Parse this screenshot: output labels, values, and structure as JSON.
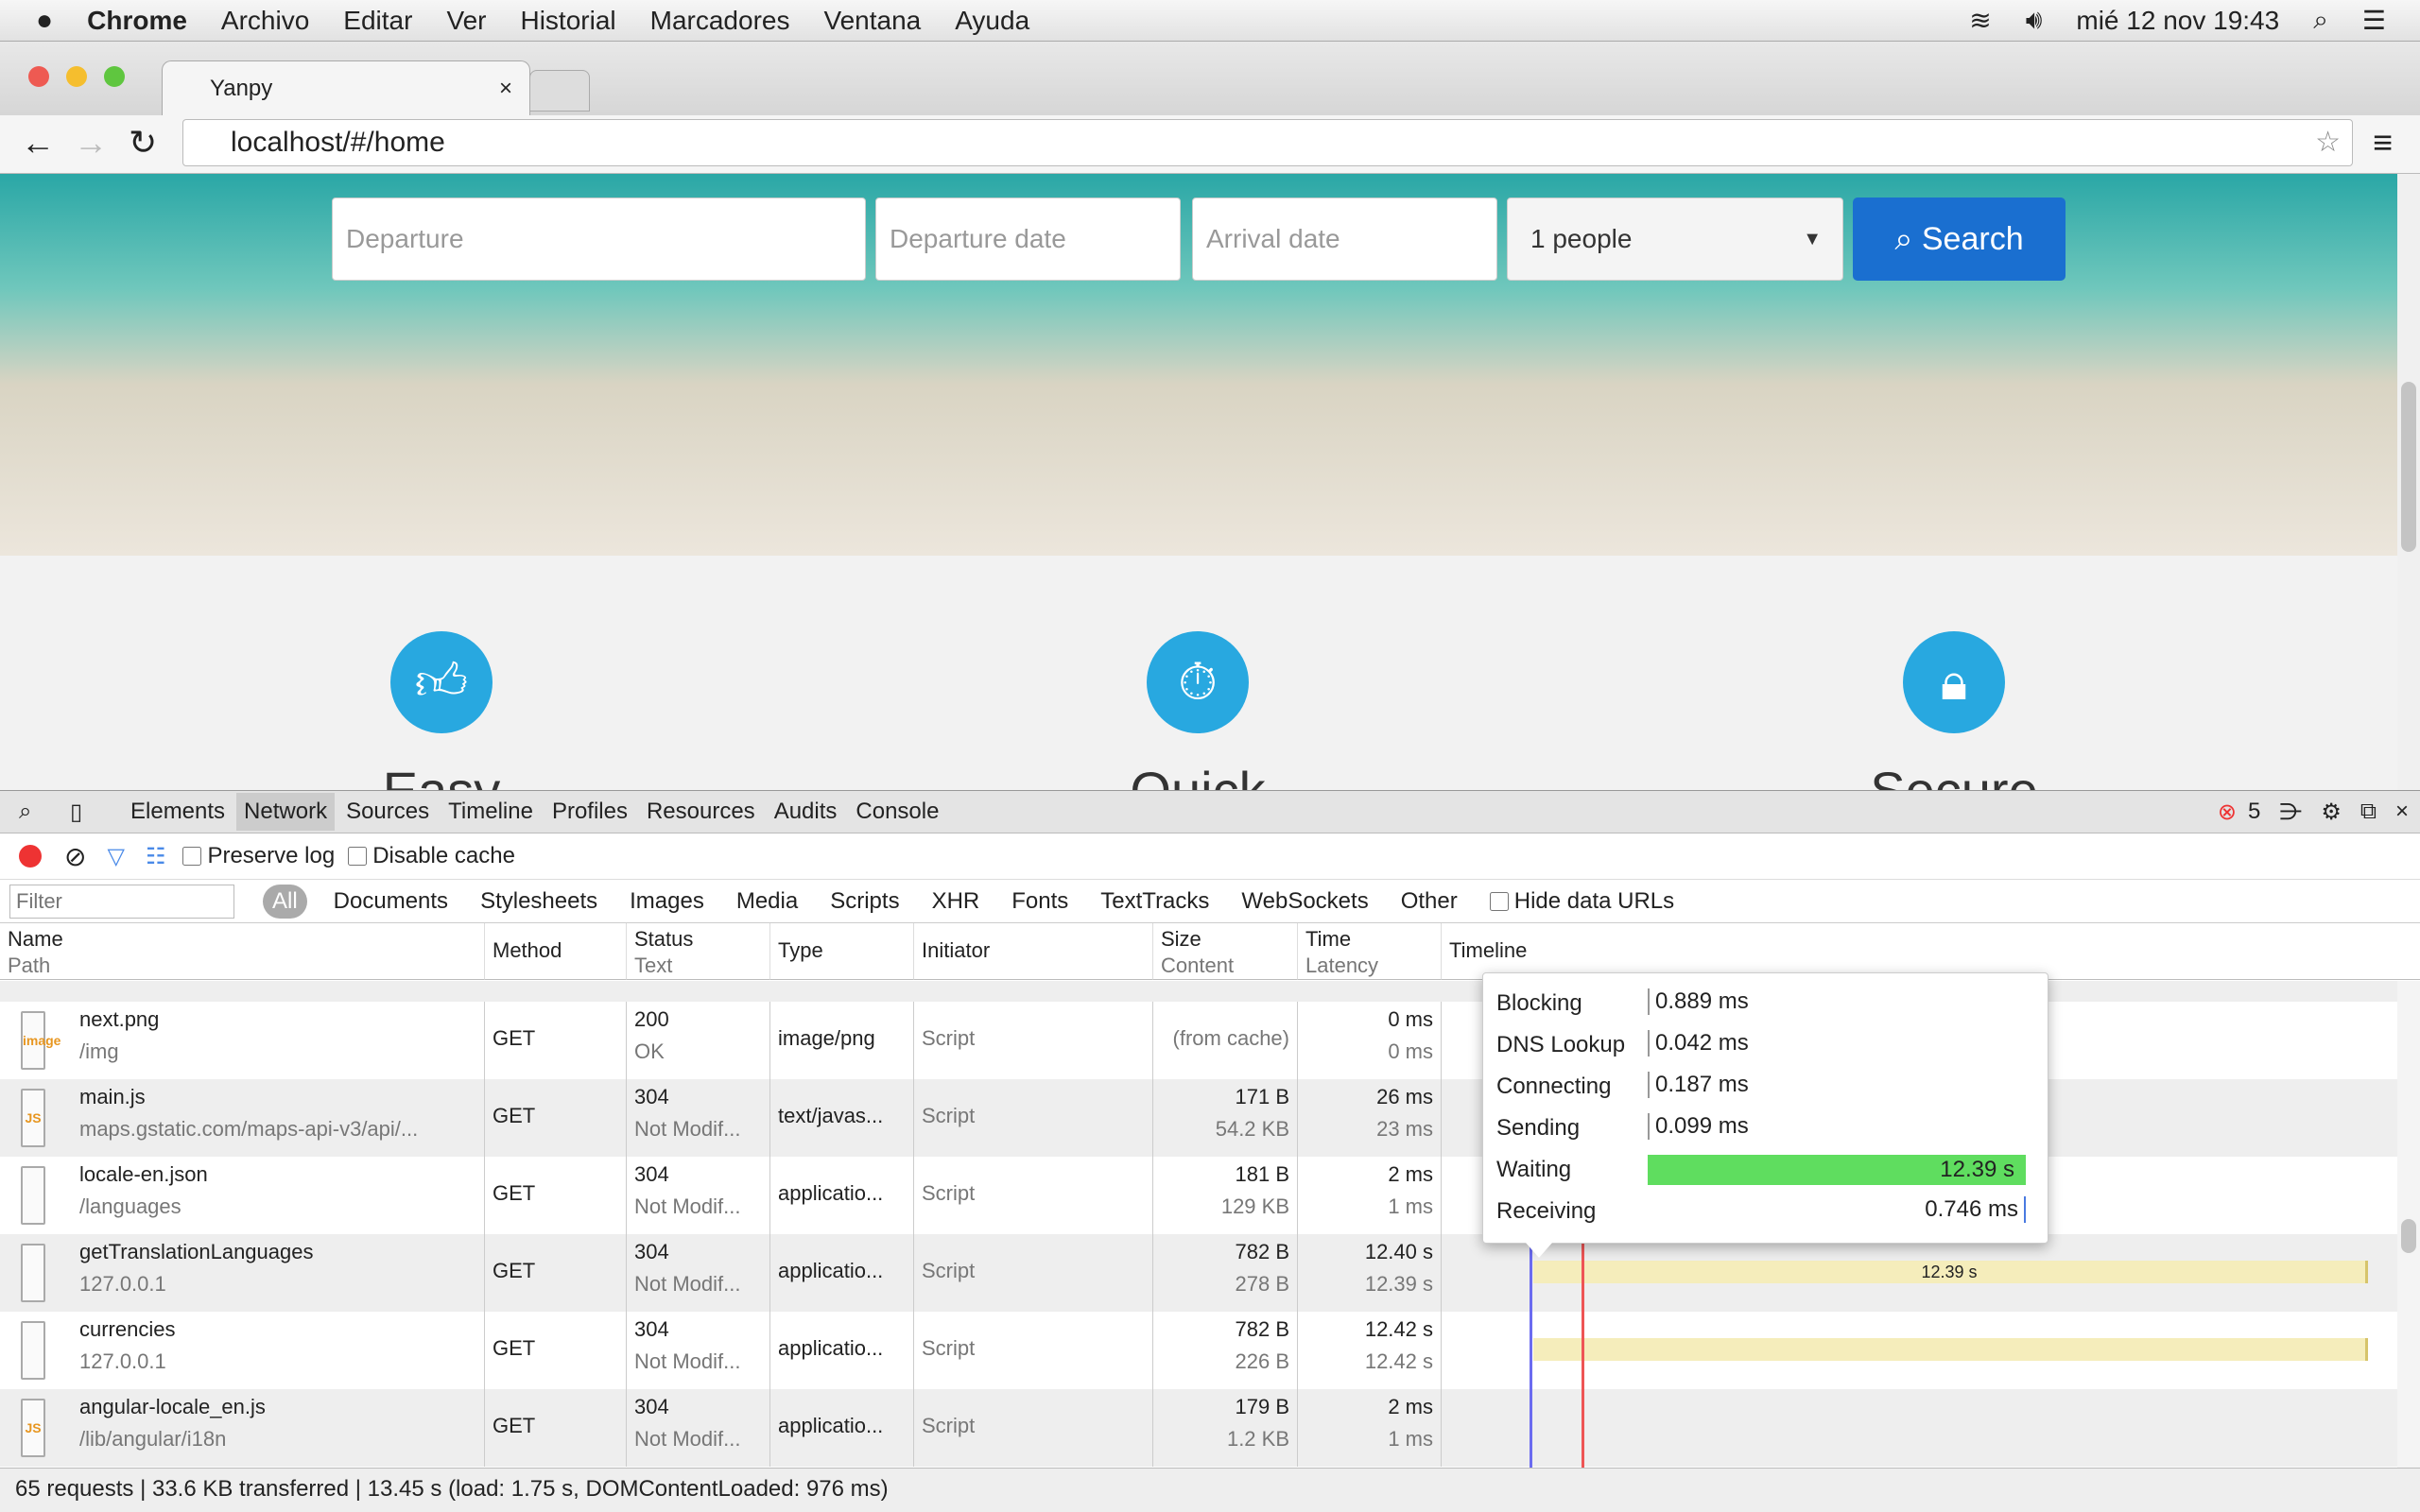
{
  "menubar": {
    "app": "Chrome",
    "items": [
      "Archivo",
      "Editar",
      "Ver",
      "Historial",
      "Marcadores",
      "Ventana",
      "Ayuda"
    ],
    "clock": "mié 12 nov  19:43"
  },
  "browser": {
    "tab_title": "Yanpy",
    "url": "localhost/#/home"
  },
  "page": {
    "departure_placeholder": "Departure",
    "departure_date_placeholder": "Departure date",
    "arrival_date_placeholder": "Arrival date",
    "people_value": "1 people",
    "search_label": "Search",
    "features": [
      {
        "title": "Easy",
        "icon": "thumbs-up-icon"
      },
      {
        "title": "Quick",
        "icon": "stopwatch-icon"
      },
      {
        "title": "Secure",
        "icon": "lock-icon"
      }
    ]
  },
  "devtools": {
    "tabs": [
      "Elements",
      "Network",
      "Sources",
      "Timeline",
      "Profiles",
      "Resources",
      "Audits",
      "Console"
    ],
    "active_tab": "Network",
    "error_count": "5",
    "preserve_log": "Preserve log",
    "disable_cache": "Disable cache",
    "filter_placeholder": "Filter",
    "filter_types": [
      "All",
      "Documents",
      "Stylesheets",
      "Images",
      "Media",
      "Scripts",
      "XHR",
      "Fonts",
      "TextTracks",
      "WebSockets",
      "Other"
    ],
    "hide_data_urls": "Hide data URLs",
    "columns": {
      "name": "Name",
      "path": "Path",
      "method": "Method",
      "status": "Status",
      "text": "Text",
      "type": "Type",
      "initiator": "Initiator",
      "size": "Size",
      "content": "Content",
      "time": "Time",
      "latency": "Latency",
      "timeline": "Timeline"
    },
    "rows": [
      {
        "name": "next.png",
        "path": "/img",
        "method": "GET",
        "status": "200",
        "text": "OK",
        "type": "image/png",
        "initiator": "Script",
        "size": "(from cache)",
        "content": "",
        "time": "0 ms",
        "latency": "0 ms",
        "icon": "image"
      },
      {
        "name": "main.js",
        "path": "maps.gstatic.com/maps-api-v3/api/...",
        "method": "GET",
        "status": "304",
        "text": "Not Modif...",
        "type": "text/javas...",
        "initiator": "Script",
        "size": "171 B",
        "content": "54.2 KB",
        "time": "26 ms",
        "latency": "23 ms",
        "icon": "JS"
      },
      {
        "name": "locale-en.json",
        "path": "/languages",
        "method": "GET",
        "status": "304",
        "text": "Not Modif...",
        "type": "applicatio...",
        "initiator": "Script",
        "size": "181 B",
        "content": "129 KB",
        "time": "2 ms",
        "latency": "1 ms",
        "icon": ""
      },
      {
        "name": "getTranslationLanguages",
        "path": "127.0.0.1",
        "method": "GET",
        "status": "304",
        "text": "Not Modif...",
        "type": "applicatio...",
        "initiator": "Script",
        "size": "782 B",
        "content": "278 B",
        "time": "12.40 s",
        "latency": "12.39 s",
        "icon": "",
        "bar_label": "12.39 s"
      },
      {
        "name": "currencies",
        "path": "127.0.0.1",
        "method": "GET",
        "status": "304",
        "text": "Not Modif...",
        "type": "applicatio...",
        "initiator": "Script",
        "size": "782 B",
        "content": "226 B",
        "time": "12.42 s",
        "latency": "12.42 s",
        "icon": ""
      },
      {
        "name": "angular-locale_en.js",
        "path": "/lib/angular/i18n",
        "method": "GET",
        "status": "304",
        "text": "Not Modif...",
        "type": "applicatio...",
        "initiator": "Script",
        "size": "179 B",
        "content": "1.2 KB",
        "time": "2 ms",
        "latency": "1 ms",
        "icon": "JS"
      }
    ],
    "timing_popup": [
      {
        "label": "Blocking",
        "value": "0.889 ms"
      },
      {
        "label": "DNS Lookup",
        "value": "0.042 ms"
      },
      {
        "label": "Connecting",
        "value": "0.187 ms"
      },
      {
        "label": "Sending",
        "value": "0.099 ms"
      },
      {
        "label": "Waiting",
        "value": "12.39 s"
      },
      {
        "label": "Receiving",
        "value": "0.746 ms"
      }
    ],
    "status_bar": "65 requests | 33.6 KB transferred | 13.45 s (load: 1.75 s, DOMContentLoaded: 976 ms)",
    "colors": {
      "waiting": "#5fdd5f",
      "bar": "#f5edbb",
      "dom_line": "#6b6bf0",
      "load_line": "#ee5555"
    }
  }
}
